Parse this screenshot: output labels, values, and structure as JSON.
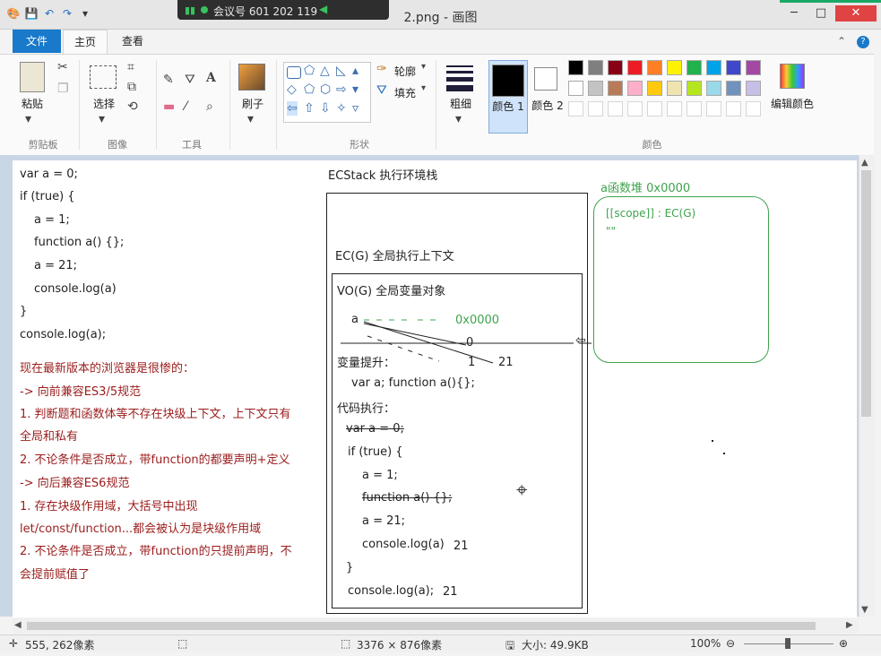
{
  "window": {
    "title": "2.png - 画图",
    "meeting": "会议号 601 202 119",
    "minimize": "─",
    "maximize": "□",
    "close": "✕"
  },
  "tabs": {
    "file": "文件",
    "home": "主页",
    "view": "查看"
  },
  "ribbon": {
    "paste": "粘贴",
    "select": "选择",
    "brushes": "刷子",
    "outline": "轮廓",
    "fill": "填充",
    "size": "粗细",
    "color1": "颜色 1",
    "color2": "颜色 2",
    "edit_colors": "编辑颜色",
    "groups": {
      "clipboard": "剪贴板",
      "image": "图像",
      "tools": "工具",
      "shapes": "形状",
      "colors": "颜色"
    },
    "palette_row1": [
      "#000000",
      "#7f7f7f",
      "#880015",
      "#ed1c24",
      "#ff7f27",
      "#fff200",
      "#22b14c",
      "#00a2e8",
      "#3f48cc",
      "#a349a4"
    ],
    "palette_row2": [
      "#ffffff",
      "#c3c3c3",
      "#b97a57",
      "#ffaec9",
      "#ffc90e",
      "#efe4b0",
      "#b5e61d",
      "#99d9ea",
      "#7092be",
      "#c8bfe7"
    ]
  },
  "canvas": {
    "code_lines": [
      "var a = 0;",
      "if (true) {",
      "a = 1;",
      "function a() {};",
      "a = 21;",
      "console.log(a)",
      "}",
      "console.log(a);"
    ],
    "notes": [
      "现在最新版本的浏览器是很惨的：",
      "-> 向前兼容ES3/5规范",
      "1. 判断题和函数体等不存在块级上下文，上下文只有",
      "全局和私有",
      "2. 不论条件是否成立，带function的都要声明+定义",
      "-> 向后兼容ES6规范",
      "1. 存在块级作用域，大括号中出现",
      "let/const/function...都会被认为是块级作用域",
      "2. 不论条件是否成立，带function的只提前声明，不",
      "会提前赋值了"
    ],
    "ecstack_title": "ECStack  执行环境栈",
    "ecg_title": "EC(G)  全局执行上下文",
    "vog_title": "VO(G) 全局变量对象",
    "var_a": "a",
    "addr_label": "0x0000",
    "val_0": "0",
    "val_1": "1",
    "val_21": "21",
    "hoist_title": "变量提升：",
    "hoist_line": "var a;  function a(){};",
    "exec_title": "代码执行：",
    "exec_lines": [
      "var a = 0;",
      "if (true) {",
      "a = 1;",
      "function a() {};",
      "a = 21;",
      "console.log(a)",
      "}",
      "console.log(a);"
    ],
    "out_21a": "21",
    "out_21b": "21",
    "heap_title": "a函数堆  0x0000",
    "heap_scope": "[[scope]] : EC(G)",
    "heap_dots": "\"\""
  },
  "status": {
    "cursor_pos": "555, 262像素",
    "dimensions": "3376 × 876像素",
    "filesize": "大小: 49.9KB",
    "zoom": "100%"
  }
}
